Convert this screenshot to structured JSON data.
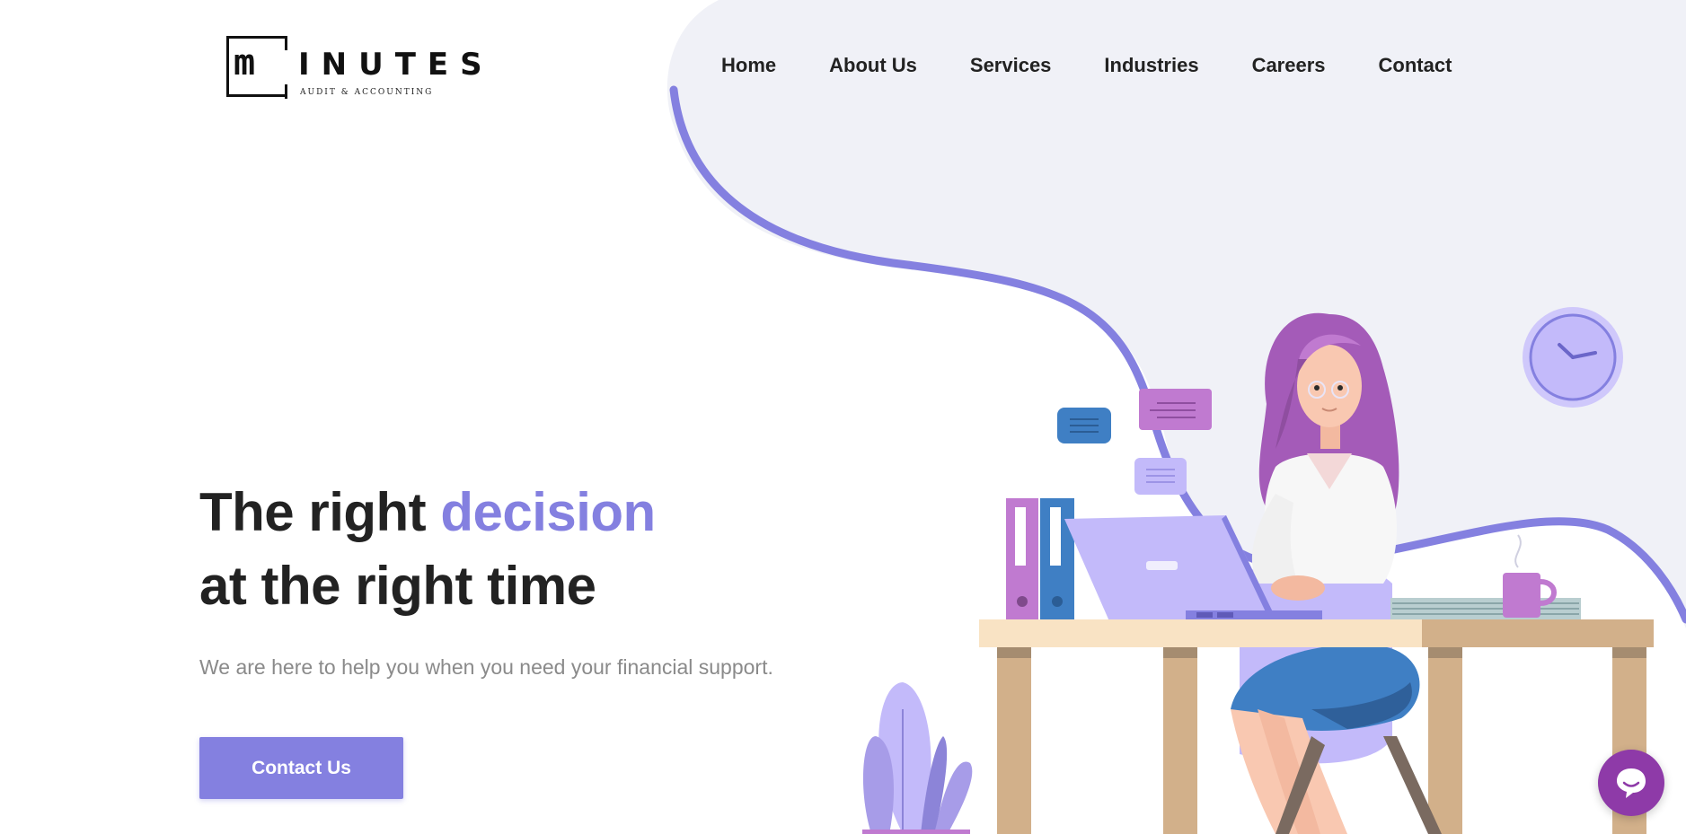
{
  "logo": {
    "mark": "m",
    "word": "INUTES",
    "tagline": "AUDIT & ACCOUNTING"
  },
  "nav": {
    "items": [
      {
        "label": "Home"
      },
      {
        "label": "About Us"
      },
      {
        "label": "Services"
      },
      {
        "label": "Industries"
      },
      {
        "label": "Careers"
      },
      {
        "label": "Contact"
      }
    ]
  },
  "hero": {
    "title_part1": "The right ",
    "title_accent": "decision",
    "title_line2": "at the right time",
    "subtitle": "We are here to help you when you need your financial support.",
    "cta_label": "Contact Us"
  },
  "chat": {
    "icon": "chat-bubble-icon"
  },
  "colors": {
    "accent": "#8480e0",
    "hero_blob": "#f0f1f7",
    "chat": "#8e3aa8",
    "text": "#222222",
    "muted": "#8a8a8a"
  }
}
